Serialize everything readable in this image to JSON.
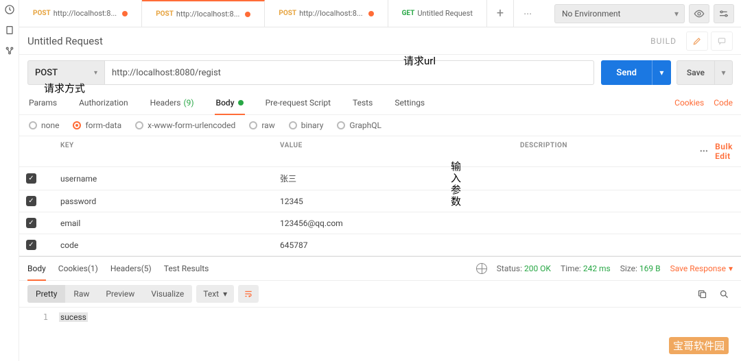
{
  "env": {
    "selected": "No Environment"
  },
  "tabs": [
    {
      "method": "POST",
      "label": "http://localhost:8..."
    },
    {
      "method": "POST",
      "label": "http://localhost:8..."
    },
    {
      "method": "POST",
      "label": "http://localhost:8..."
    },
    {
      "method": "GET",
      "label": "Untitled Request"
    }
  ],
  "title": "Untitled Request",
  "build_label": "BUILD",
  "request": {
    "method": "POST",
    "url": "http://localhost:8080/regist",
    "send_label": "Send",
    "save_label": "Save"
  },
  "annotations": {
    "url_label": "请求url",
    "method_label": "请求方式",
    "params_label": "输入参数"
  },
  "req_tabs": {
    "params": "Params",
    "auth": "Authorization",
    "headers": "Headers",
    "headers_count": "(9)",
    "body": "Body",
    "prerequest": "Pre-request Script",
    "tests": "Tests",
    "settings": "Settings",
    "cookies_link": "Cookies",
    "code_link": "Code"
  },
  "body_types": {
    "none": "none",
    "formdata": "form-data",
    "urlencoded": "x-www-form-urlencoded",
    "raw": "raw",
    "binary": "binary",
    "graphql": "GraphQL"
  },
  "params_table": {
    "headers": {
      "key": "KEY",
      "value": "VALUE",
      "description": "DESCRIPTION"
    },
    "bulk_edit": "Bulk Edit",
    "rows": [
      {
        "key": "username",
        "value": "张三"
      },
      {
        "key": "password",
        "value": "12345"
      },
      {
        "key": "email",
        "value": "123456@qq.com"
      },
      {
        "key": "code",
        "value": "645787"
      }
    ]
  },
  "resp_tabs": {
    "body": "Body",
    "cookies": "Cookies",
    "cookies_count": "(1)",
    "headers": "Headers",
    "headers_count": "(5)",
    "test_results": "Test Results",
    "status_label": "Status:",
    "status_value": "200 OK",
    "time_label": "Time:",
    "time_value": "242 ms",
    "size_label": "Size:",
    "size_value": "169 B",
    "save_response": "Save Response"
  },
  "resp_toolbar": {
    "pretty": "Pretty",
    "raw": "Raw",
    "preview": "Preview",
    "visualize": "Visualize",
    "format": "Text"
  },
  "response_body": {
    "line1_num": "1",
    "line1_text": "sucess"
  },
  "watermark": "宝哥软件园"
}
